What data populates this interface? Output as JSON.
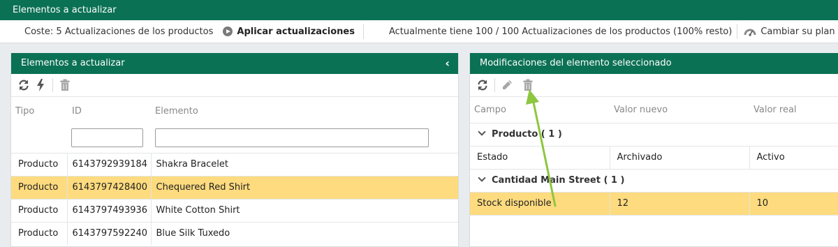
{
  "window": {
    "title": "Elementos a actualizar"
  },
  "cost_bar": {
    "cost_text": "Coste: 5 Actualizaciones de los productos",
    "apply_label": "Aplicar actualizaciones",
    "quota_text": "Actualmente tiene 100 / 100 Actualizaciones de los productos (100% resto)",
    "plan_label": "Cambiar su plan"
  },
  "left_panel": {
    "title": "Elementos a actualizar",
    "columns": [
      "Tipo",
      "ID",
      "Elemento"
    ],
    "filters": {
      "id_value": "",
      "element_value": ""
    },
    "rows": [
      {
        "tipo": "Producto",
        "id": "6143792939184",
        "elemento": "Shakra Bracelet"
      },
      {
        "tipo": "Producto",
        "id": "6143797428400",
        "elemento": "Chequered Red Shirt"
      },
      {
        "tipo": "Producto",
        "id": "6143797493936",
        "elemento": "White Cotton Shirt"
      },
      {
        "tipo": "Producto",
        "id": "6143797592240",
        "elemento": "Blue Silk Tuxedo"
      }
    ],
    "selected_index": 1
  },
  "right_panel": {
    "title": "Modificaciones del elemento seleccionado",
    "columns": [
      "Campo",
      "Valor nuevo",
      "Valor real"
    ],
    "groups": [
      {
        "label": "Producto ( 1 )",
        "rows": [
          {
            "campo": "Estado",
            "nuevo": "Archivado",
            "real": "Activo"
          }
        ]
      },
      {
        "label": "Cantidad Main Street ( 1 )",
        "rows": [
          {
            "campo": "Stock disponible",
            "nuevo": "12",
            "real": "10"
          }
        ]
      }
    ]
  },
  "colors": {
    "header_green": "#0b7154",
    "selected_row": "#fddb7e",
    "arrow_green": "#8dc63f"
  },
  "icons": [
    "refresh-icon",
    "bolt-icon",
    "trash-icon",
    "pencil-icon",
    "play-icon",
    "gauge-icon",
    "chevron-left-icon",
    "chevron-down-icon"
  ]
}
